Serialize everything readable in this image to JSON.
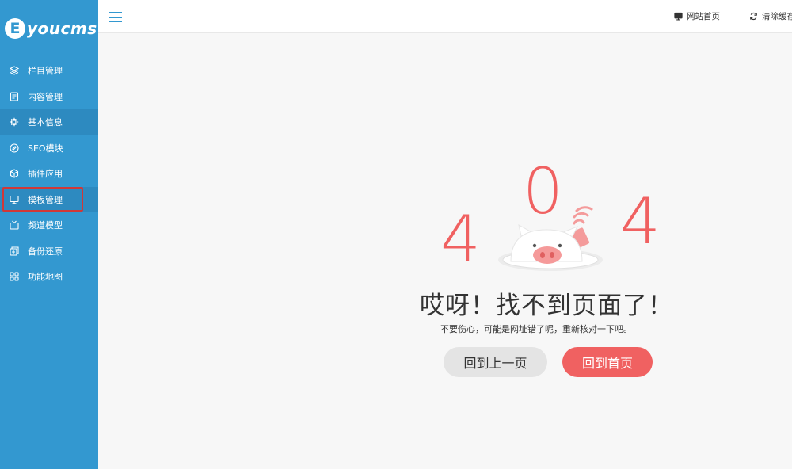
{
  "app": {
    "logo_text": "youcms",
    "logo_letter": "E"
  },
  "sidebar": {
    "items": [
      {
        "label": "栏目管理",
        "icon": "layers-icon"
      },
      {
        "label": "内容管理",
        "icon": "document-icon"
      },
      {
        "label": "基本信息",
        "icon": "gear-icon"
      },
      {
        "label": "SEO模块",
        "icon": "seo-icon"
      },
      {
        "label": "插件应用",
        "icon": "cube-icon"
      },
      {
        "label": "模板管理",
        "icon": "monitor-icon"
      },
      {
        "label": "频道模型",
        "icon": "tv-icon"
      },
      {
        "label": "备份还原",
        "icon": "backup-icon"
      },
      {
        "label": "功能地图",
        "icon": "grid-icon"
      }
    ],
    "active_index": 2,
    "highlighted_index": 5
  },
  "topbar": {
    "site_home_label": "网站首页",
    "clear_cache_label": "清除缓存"
  },
  "error": {
    "digits": [
      "4",
      "0",
      "4"
    ],
    "title": "哎呀！找不到页面了！",
    "subtitle": "不要伤心，可能是网址错了呢，重新核对一下吧。",
    "back_label": "回到上一页",
    "home_label": "回到首页"
  },
  "colors": {
    "sidebar": "#3398d0",
    "accent_red": "#f06161",
    "highlight_border": "#d03838"
  }
}
